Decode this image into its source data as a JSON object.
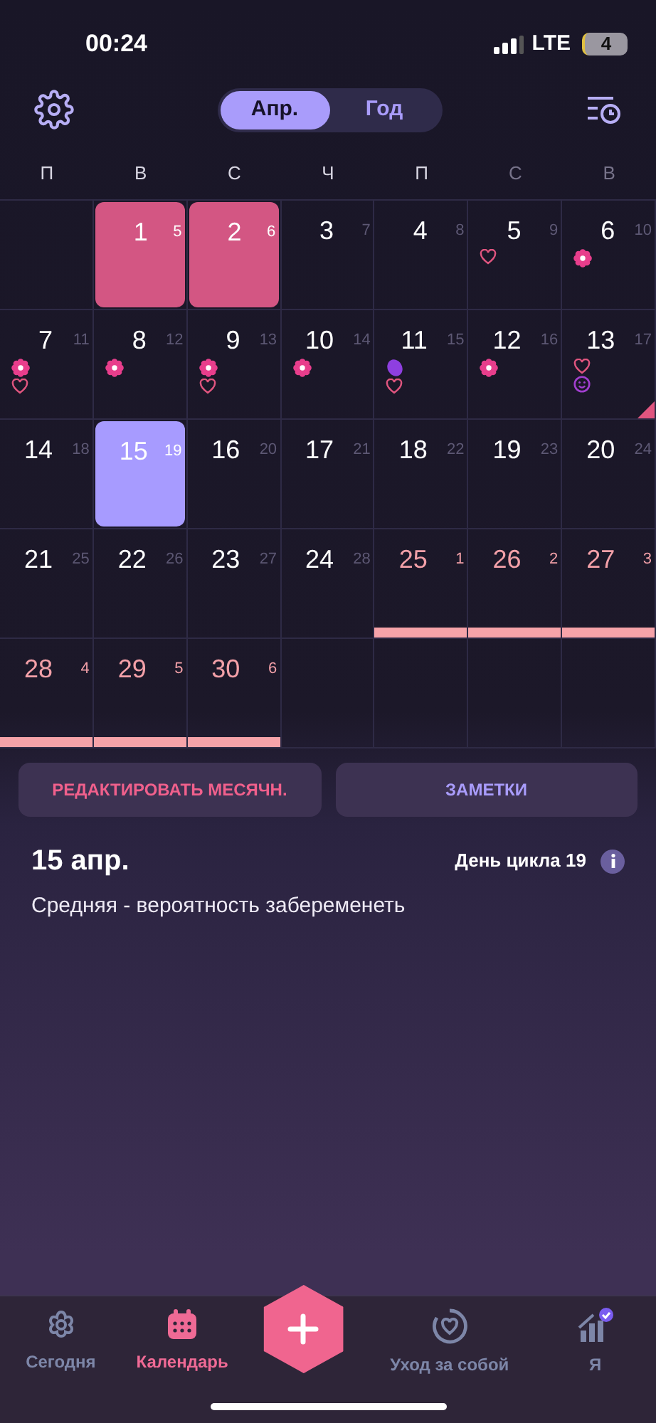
{
  "status_bar": {
    "time": "00:24",
    "network": "LTE",
    "battery": "4"
  },
  "header": {
    "segments": [
      {
        "label": "Апр.",
        "selected": true
      },
      {
        "label": "Год",
        "selected": false
      }
    ]
  },
  "calendar": {
    "weekdays": [
      {
        "label": "П",
        "weekend": false
      },
      {
        "label": "В",
        "weekend": false
      },
      {
        "label": "С",
        "weekend": false
      },
      {
        "label": "Ч",
        "weekend": false
      },
      {
        "label": "П",
        "weekend": false
      },
      {
        "label": "С",
        "weekend": true
      },
      {
        "label": "В",
        "weekend": true
      }
    ],
    "days": [
      {
        "kind": "empty"
      },
      {
        "kind": "period",
        "day": "1",
        "cycle_day": "5",
        "flag": false
      },
      {
        "kind": "period",
        "day": "2",
        "cycle_day": "6",
        "flag": false
      },
      {
        "kind": "normal",
        "day": "3",
        "cycle_day": "7",
        "flag": false
      },
      {
        "kind": "normal",
        "day": "4",
        "cycle_day": "8",
        "flag": false
      },
      {
        "kind": "normal",
        "day": "5",
        "cycle_day": "9",
        "flag": false,
        "markers": [
          {
            "kind": "heart"
          }
        ]
      },
      {
        "kind": "normal",
        "day": "6",
        "cycle_day": "10",
        "flag": false,
        "markers": [
          {
            "kind": "flower"
          }
        ]
      },
      {
        "kind": "normal",
        "day": "7",
        "cycle_day": "11",
        "flag": false,
        "markers": [
          {
            "kind": "flower"
          },
          {
            "kind": "heart"
          }
        ]
      },
      {
        "kind": "normal",
        "day": "8",
        "cycle_day": "12",
        "flag": false,
        "markers": [
          {
            "kind": "flower"
          }
        ]
      },
      {
        "kind": "normal",
        "day": "9",
        "cycle_day": "13",
        "flag": false,
        "markers": [
          {
            "kind": "flower"
          },
          {
            "kind": "heart"
          }
        ]
      },
      {
        "kind": "normal",
        "day": "10",
        "cycle_day": "14",
        "flag": false,
        "markers": [
          {
            "kind": "flower"
          }
        ]
      },
      {
        "kind": "normal",
        "day": "11",
        "cycle_day": "15",
        "flag": false,
        "markers": [
          {
            "kind": "egg"
          },
          {
            "kind": "heart"
          }
        ]
      },
      {
        "kind": "normal",
        "day": "12",
        "cycle_day": "16",
        "flag": false,
        "markers": [
          {
            "kind": "flower"
          }
        ]
      },
      {
        "kind": "normal",
        "day": "13",
        "cycle_day": "17",
        "flag": true,
        "markers": [
          {
            "kind": "heart"
          },
          {
            "kind": "smile"
          }
        ]
      },
      {
        "kind": "normal",
        "day": "14",
        "cycle_day": "18",
        "flag": false
      },
      {
        "kind": "selected",
        "day": "15",
        "cycle_day": "19",
        "flag": false
      },
      {
        "kind": "normal",
        "day": "16",
        "cycle_day": "20",
        "flag": false
      },
      {
        "kind": "normal",
        "day": "17",
        "cycle_day": "21",
        "flag": false
      },
      {
        "kind": "normal",
        "day": "18",
        "cycle_day": "22",
        "flag": false
      },
      {
        "kind": "normal",
        "day": "19",
        "cycle_day": "23",
        "flag": false
      },
      {
        "kind": "normal",
        "day": "20",
        "cycle_day": "24",
        "flag": false
      },
      {
        "kind": "normal",
        "day": "21",
        "cycle_day": "25",
        "flag": false
      },
      {
        "kind": "normal",
        "day": "22",
        "cycle_day": "26",
        "flag": false
      },
      {
        "kind": "normal",
        "day": "23",
        "cycle_day": "27",
        "flag": false
      },
      {
        "kind": "normal",
        "day": "24",
        "cycle_day": "28",
        "flag": false
      },
      {
        "kind": "predicted",
        "day": "25",
        "cycle_day": "1",
        "flag": false
      },
      {
        "kind": "predicted",
        "day": "26",
        "cycle_day": "2",
        "flag": false
      },
      {
        "kind": "predicted",
        "day": "27",
        "cycle_day": "3",
        "flag": false
      },
      {
        "kind": "predicted",
        "day": "28",
        "cycle_day": "4",
        "flag": false
      },
      {
        "kind": "predicted",
        "day": "29",
        "cycle_day": "5",
        "flag": false
      },
      {
        "kind": "predicted",
        "day": "30",
        "cycle_day": "6",
        "flag": false
      },
      {
        "kind": "empty"
      },
      {
        "kind": "empty"
      },
      {
        "kind": "empty"
      },
      {
        "kind": "empty"
      }
    ]
  },
  "actions": [
    {
      "label": "РЕДАКТИРОВАТЬ МЕСЯЧН.",
      "kind": "period"
    },
    {
      "label": "ЗАМЕТКИ",
      "kind": "notes"
    }
  ],
  "day_info": {
    "date": "15 апр.",
    "cycle_day": "День цикла 19",
    "description": "Средняя - вероятность забеременеть"
  },
  "bottom_nav": [
    {
      "label": "Сегодня",
      "kind": "today",
      "selected": false
    },
    {
      "label": "Календарь",
      "kind": "calendar",
      "selected": true
    },
    {
      "kind": "add"
    },
    {
      "label": "Уход за собой",
      "kind": "care",
      "selected": false
    },
    {
      "label": "Я",
      "kind": "me",
      "selected": false
    }
  ]
}
